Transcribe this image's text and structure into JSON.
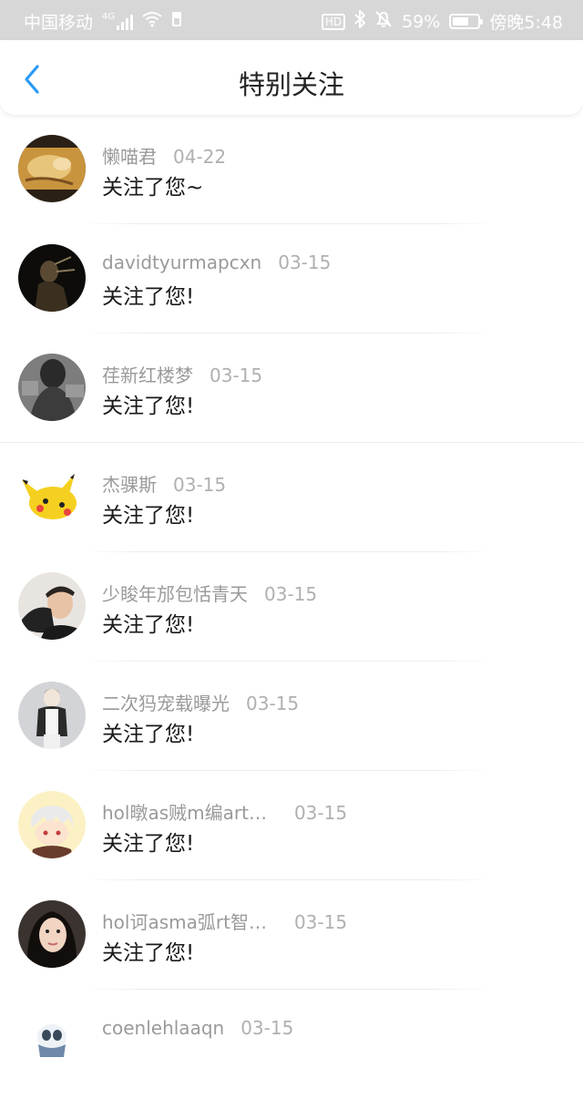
{
  "status_bar": {
    "carrier": "中国移动",
    "network": "4G",
    "hd": "HD",
    "battery": "59%",
    "time": "傍晚5:48",
    "icons": [
      "signal-icon",
      "wifi-icon",
      "sim-icon",
      "bluetooth-icon",
      "mute-bell-icon",
      "battery-icon"
    ]
  },
  "header": {
    "title": "特别关注",
    "back_icon": "chevron-left-icon",
    "accent": "#2b9af3"
  },
  "list": [
    {
      "name": "懒喵君",
      "date": "04-22",
      "message": "关注了您~"
    },
    {
      "name": "davidtyurmapcxn",
      "date": "03-15",
      "message": "关注了您!"
    },
    {
      "name": "荏新红楼梦",
      "date": "03-15",
      "message": "关注了您!"
    },
    {
      "name": "杰骒斯",
      "date": "03-15",
      "message": "关注了您!"
    },
    {
      "name": "少睃年邡包恬青天",
      "date": "03-15",
      "message": "关注了您!"
    },
    {
      "name": "二次犸宠载曝光",
      "date": "03-15",
      "message": "关注了您!"
    },
    {
      "name": "hol暾as贼m编art…",
      "date": "03-15",
      "message": "关注了您!"
    },
    {
      "name": "hol诃asma弧rt智…",
      "date": "03-15",
      "message": "关注了您!"
    },
    {
      "name": "coenlehlaaqn",
      "date": "03-15",
      "message": ""
    }
  ]
}
